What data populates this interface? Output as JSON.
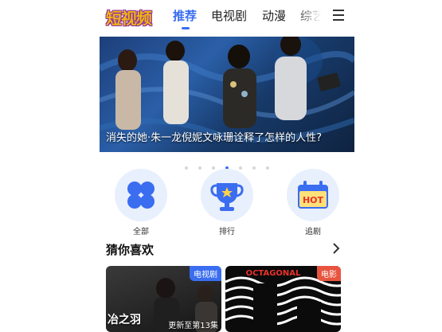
{
  "header": {
    "logo_text": "短视频",
    "tabs": [
      {
        "label": "推荐",
        "active": true
      },
      {
        "label": "电视剧",
        "active": false
      },
      {
        "label": "动漫",
        "active": false
      },
      {
        "label": "综艺",
        "active": false
      }
    ],
    "menu_icon": "hamburger-menu-icon"
  },
  "banner": {
    "caption": "消失的她·朱一龙倪妮文咏珊诠释了怎样的人性?",
    "dots_count": 7,
    "active_dot": 3
  },
  "categories": [
    {
      "label": "全部",
      "icon": "grid-icon"
    },
    {
      "label": "排行",
      "icon": "trophy-icon"
    },
    {
      "label": "追剧",
      "icon": "hot-calendar-icon",
      "icon_text": "HOT"
    }
  ],
  "recommend": {
    "title": "猜你喜欢",
    "cards": [
      {
        "badge": "电视剧",
        "badge_color": "#3a6df0",
        "overlay_text": "冶之羽",
        "status": "更新至第13集"
      },
      {
        "badge": "电影",
        "badge_color": "#e8543f",
        "top_text": "OCTAGONAL"
      }
    ]
  },
  "colors": {
    "accent": "#3a6df0",
    "logo": "#f1b516",
    "category_bg": "#e8effd"
  }
}
